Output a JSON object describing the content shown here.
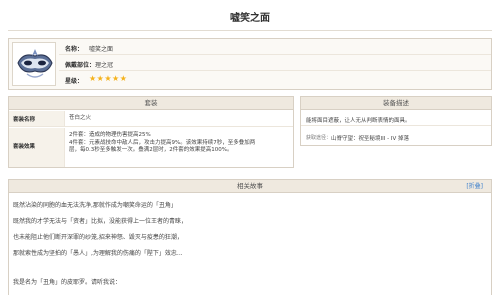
{
  "page": {
    "title": "嘘笑之面"
  },
  "item": {
    "name_label": "名称：",
    "name_value": "嘘笑之面",
    "slot_label": "佩戴部位：",
    "slot_value": "理之冠",
    "rarity_label": "星级：",
    "stars": "★★★★★",
    "rarity": 5
  },
  "set": {
    "header": "套装",
    "name_label": "套装名称",
    "name_value": "苍白之火",
    "effect_label": "套装效果",
    "effect_lines": [
      "2件套：造成的物理伤害提高25%",
      "4件套：元素战技命中敌人后，攻击力提高9%。该效果持续7秒，至多叠加两",
      "层，每0.3秒至多触发一次。叠满2层时，2件套的效果提高100%。"
    ]
  },
  "description": {
    "header": "装备描述",
    "text": "能将面目遮蔽，让人无从判断表情的面具。",
    "source_label": "获取途径：",
    "source_value": "山脊守望：祝圣秘境III - IV 掉落"
  },
  "story": {
    "header": "相关故事",
    "fold_label": "[折叠]",
    "lines": [
      "既然沾染的同胞的血无法洗净,那就作成为嘲笑命运的「丑角」",
      "既然我的才学无法与「资者」比拟，没能获得上一位王者的青睐，",
      "也未能阻止他们断开深罪的纱笼,招来神怒、毁灭与疫患的狂潮，",
      "那就索性成为坚拍的「愚人」,为理解我的伤痛的「陛下」效忠...",
      "我是名为「丑角」的皮耶罗。请听我说："
    ]
  },
  "colors": {
    "star": "#f5b21b",
    "link": "#3b7fcc",
    "header_bg": "#efe9df"
  }
}
